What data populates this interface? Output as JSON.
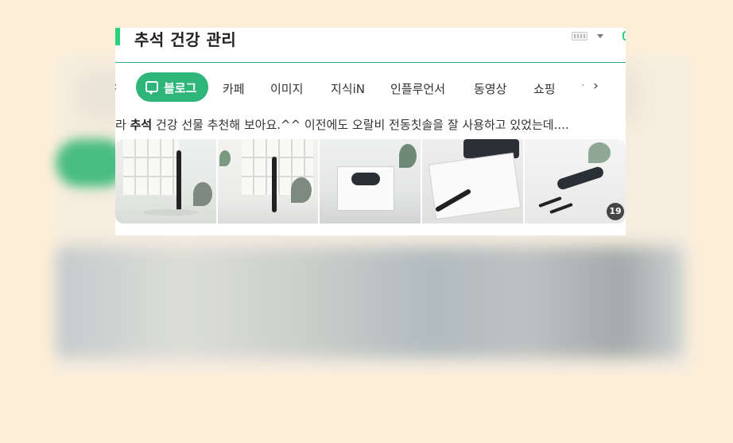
{
  "header": {
    "title": "추석 건강 관리"
  },
  "tabs": {
    "items": [
      {
        "label": "블로그",
        "active": true
      },
      {
        "label": "카페"
      },
      {
        "label": "이미지"
      },
      {
        "label": "지식iN"
      },
      {
        "label": "인플루언서"
      },
      {
        "label": "동영상"
      },
      {
        "label": "쇼핑"
      }
    ],
    "more": "·"
  },
  "snippet": {
    "prefix": "라 ",
    "highlight": "추석",
    "text": " 건강 선물 추천해 보아요.^^ 이전에도 오랄비 전동칫솔을 잘 사용하고 있었는데...."
  },
  "thumbnails": {
    "count_badge": "19"
  },
  "colors": {
    "brand_green": "#2db57a",
    "accent_green": "#2dd07a",
    "background": "#fdefd7"
  }
}
